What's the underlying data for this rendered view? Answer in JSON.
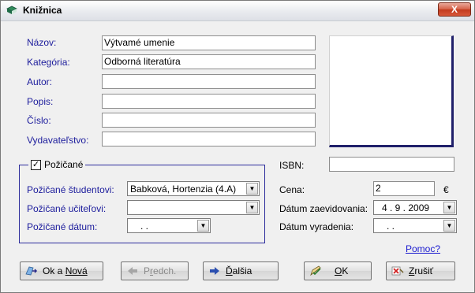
{
  "window": {
    "title": "Knižnica",
    "close_label": "X"
  },
  "form": {
    "nazov_label": "Názov:",
    "nazov_value": "Výtvamé umenie",
    "kategoria_label": "Kategória:",
    "kategoria_value": "Odborná literatúra",
    "autor_label": "Autor:",
    "autor_value": "",
    "popis_label": "Popis:",
    "popis_value": "",
    "cislo_label": "Číslo:",
    "cislo_value": "",
    "vydavatelstvo_label": "Vydavateľstvo:",
    "vydavatelstvo_value": ""
  },
  "loan": {
    "legend": "Požičané",
    "checked_mark": "✓",
    "student_label": "Požičané študentovi:",
    "student_value": "Babková, Hortenzia (4.A)",
    "teacher_label": "Požičané učiteľovi:",
    "teacher_value": "",
    "date_label": "Požičané dátum:",
    "date_value": ". ."
  },
  "details": {
    "isbn_label": "ISBN:",
    "isbn_value": "",
    "cena_label": "Cena:",
    "cena_value": "2",
    "currency": "€",
    "zaevid_label": "Dátum zaevidovania:",
    "zaevid_value": "4 . 9 . 2009",
    "vyrad_label": "Dátum vyradenia:",
    "vyrad_value": ". ."
  },
  "help_link": "Pomoc?",
  "buttons": {
    "ok_nova": [
      "Ok a ",
      "Nová"
    ],
    "predch": [
      "P",
      "r",
      "edch."
    ],
    "dalsia": [
      "",
      "Ď",
      "alšia"
    ],
    "ok": [
      "",
      "O",
      "K"
    ],
    "zrusit": [
      "",
      "Z",
      "rušiť"
    ]
  },
  "icons": {
    "app": "book-icon",
    "ok_nova": "save-new-icon",
    "predch": "arrow-left-icon",
    "dalsia": "arrow-right-icon",
    "ok": "check-pen-icon",
    "zrusit": "cancel-icon",
    "dropdown": "chevron-down-icon"
  }
}
